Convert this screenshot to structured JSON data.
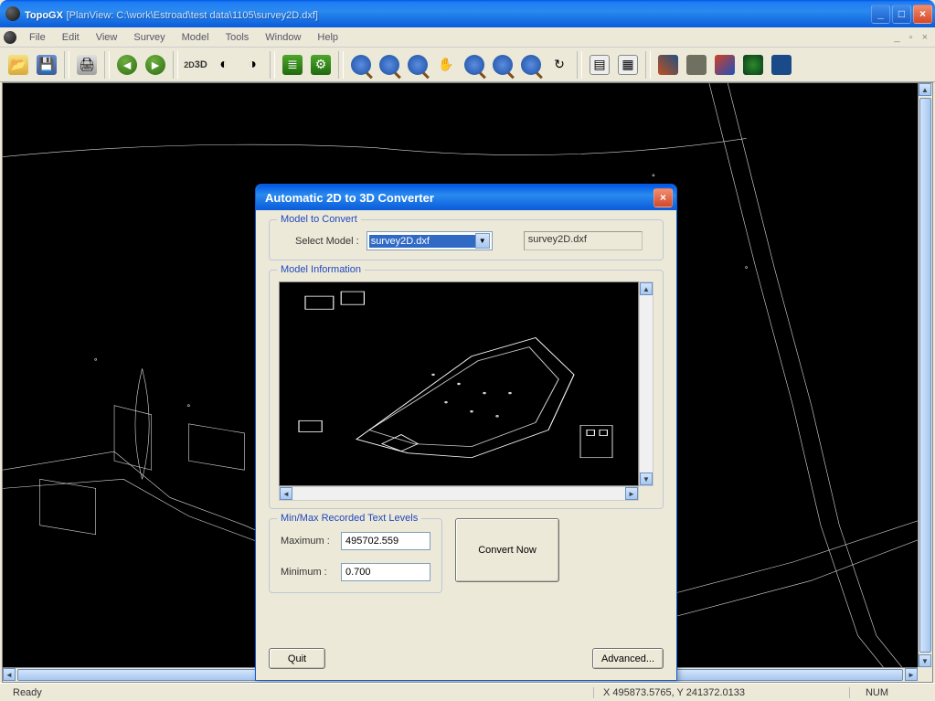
{
  "window": {
    "app_name": "TopoGX",
    "document_title": "[PlanView: C:\\work\\Estroad\\test data\\1105\\survey2D.dxf]"
  },
  "menubar": {
    "items": [
      "File",
      "Edit",
      "View",
      "Survey",
      "Model",
      "Tools",
      "Window",
      "Help"
    ]
  },
  "statusbar": {
    "ready": "Ready",
    "coords": "X 495873.5765, Y 241372.0133",
    "num": "NUM"
  },
  "dialog": {
    "title": "Automatic 2D to 3D Converter",
    "group_model_to_convert": "Model to Convert",
    "select_model_label": "Select Model :",
    "select_model_value": "survey2D.dxf",
    "readonly_filename": "survey2D.dxf",
    "group_model_info": "Model Information",
    "group_minmax": "Min/Max Recorded Text Levels",
    "maximum_label": "Maximum :",
    "maximum_value": "495702.559",
    "minimum_label": "Minimum :",
    "minimum_value": "0.700",
    "convert_button": "Convert Now",
    "quit_button": "Quit",
    "advanced_button": "Advanced..."
  }
}
